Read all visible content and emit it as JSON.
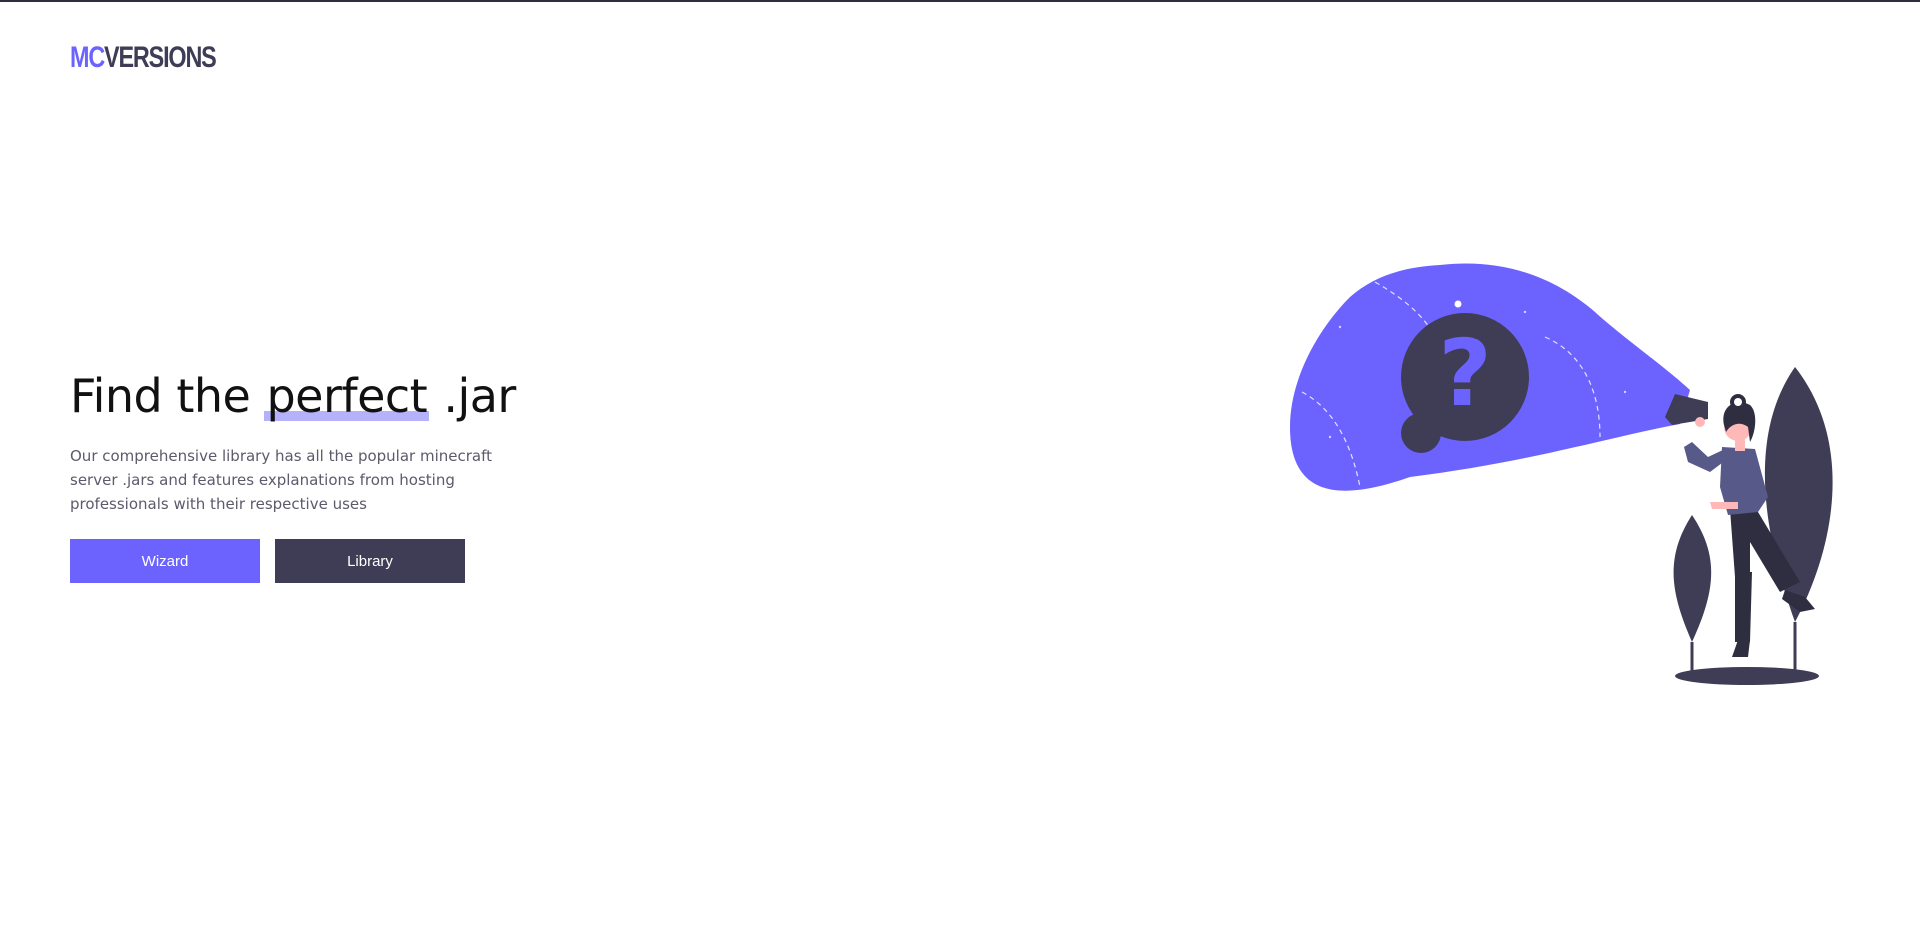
{
  "brand": {
    "logo_prefix": "MC",
    "logo_suffix": "VERSIONS"
  },
  "hero": {
    "headline_before": "Find the ",
    "headline_highlight": "perfect",
    "headline_after": " .jar",
    "description": "Our comprehensive library has all the popular minecraft server .jars and features explanations from hosting professionals with their respective uses"
  },
  "actions": {
    "wizard_label": "Wizard",
    "library_label": "Library"
  },
  "illustration": {
    "icon": "question-mark-searchlight-illustration",
    "question_glyph": "?"
  },
  "colors": {
    "accent": "#6c63ff",
    "dark": "#3f3d56",
    "text_muted": "#5b5b6b",
    "highlight": "#b5b1fb"
  }
}
